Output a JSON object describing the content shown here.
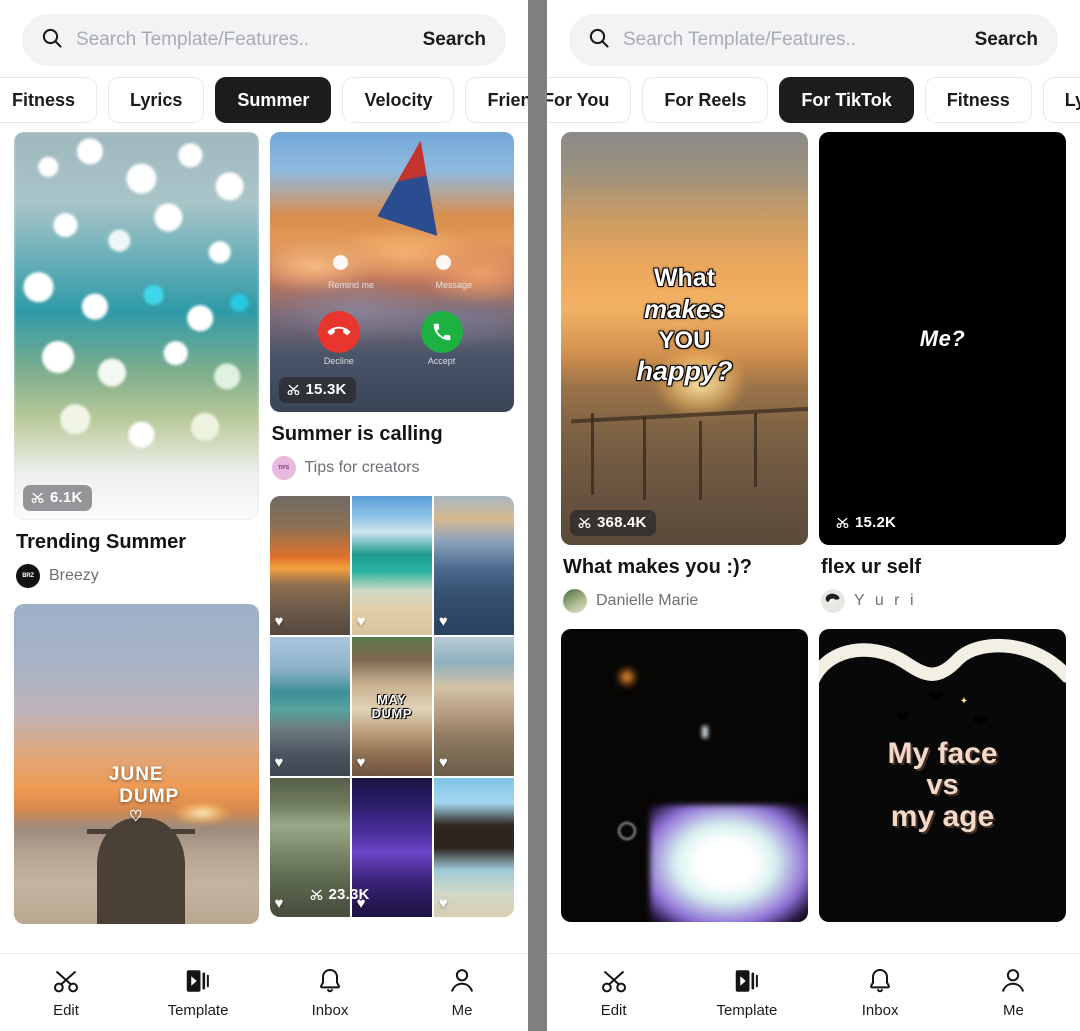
{
  "search": {
    "placeholder": "Search Template/Features..",
    "value": "",
    "button_label": "Search",
    "icon": "search-icon"
  },
  "left_panel": {
    "chips": [
      {
        "label": "Fitness",
        "active": false
      },
      {
        "label": "Lyrics",
        "active": false
      },
      {
        "label": "Summer",
        "active": true
      },
      {
        "label": "Velocity",
        "active": false
      },
      {
        "label": "Friends",
        "active": false
      }
    ],
    "cards": [
      {
        "title": "Trending Summer",
        "author": "Breezy",
        "uses": "6.1K",
        "badge_icon": "scissors-icon",
        "artwork": "bokeh-water"
      },
      {
        "title": "Summer is calling",
        "author": "Tips for creators",
        "uses": "15.3K",
        "badge_icon": "scissors-icon",
        "artwork": "airplane-wing-call-screen",
        "overlay_text": {
          "remind": "Remind me",
          "message": "Message",
          "decline": "Decline",
          "accept": "Accept"
        }
      },
      {
        "title": "",
        "author": "",
        "uses": "",
        "artwork": "june-dump-beach",
        "overlay_text": {
          "line1": "JUNE",
          "line2": "DUMP",
          "heart": "♡"
        }
      },
      {
        "title": "",
        "author": "",
        "uses": "23.3K",
        "badge_icon": "scissors-icon",
        "artwork": "photo-collage-3x3",
        "overlay_text": {
          "line1": "MAY",
          "line2": "DUMP"
        }
      }
    ]
  },
  "right_panel": {
    "chips": [
      {
        "label": "For You",
        "active": false
      },
      {
        "label": "For Reels",
        "active": false
      },
      {
        "label": "For TikTok",
        "active": true
      },
      {
        "label": "Fitness",
        "active": false
      },
      {
        "label": "Lyrics",
        "active": false
      }
    ],
    "cards": [
      {
        "title": "What makes you :)?",
        "author": "Danielle Marie",
        "uses": "368.4K",
        "badge_icon": "scissors-icon",
        "artwork": "sunset-pier",
        "overlay_text": {
          "l1": "What",
          "l2": "makes",
          "l3": "YOU",
          "l4": "happy?"
        }
      },
      {
        "title": "flex ur self",
        "author": "Y u r i",
        "uses": "15.2K",
        "badge_icon": "scissors-icon",
        "artwork": "black-me-question",
        "overlay_text": {
          "l1": "Me?"
        }
      },
      {
        "title": "",
        "author": "",
        "uses": "",
        "artwork": "dark-glowing-phone"
      },
      {
        "title": "",
        "author": "",
        "uses": "",
        "artwork": "my-face-vs-my-age",
        "overlay_text": {
          "l1": "My face",
          "l2": "vs",
          "l3": "my age"
        }
      }
    ]
  },
  "bottom_nav": {
    "items": [
      {
        "label": "Edit",
        "icon": "scissors-icon",
        "active": false
      },
      {
        "label": "Template",
        "icon": "template-play-icon",
        "active": true
      },
      {
        "label": "Inbox",
        "icon": "bell-icon",
        "active": false
      },
      {
        "label": "Me",
        "icon": "person-icon",
        "active": false
      }
    ]
  },
  "colors": {
    "accent_dark": "#1c1c1e",
    "search_bg": "#f2f3f5",
    "divider": "#808080",
    "badge_bg": "rgba(40,40,42,.72)"
  }
}
